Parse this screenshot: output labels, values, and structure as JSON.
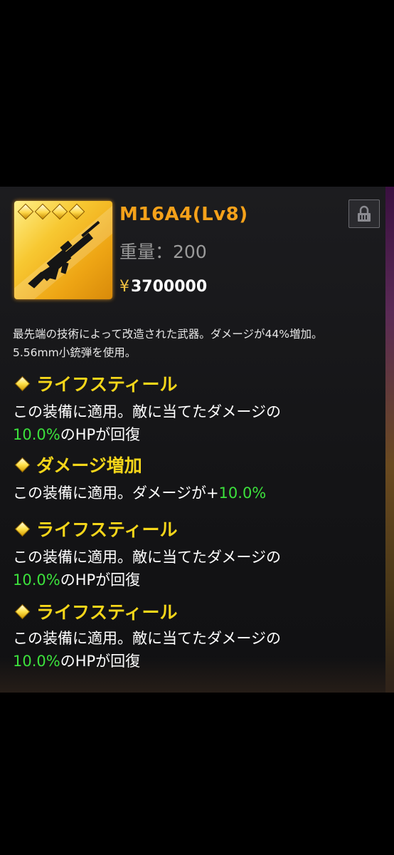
{
  "item": {
    "name": "M16A4(Lv8)",
    "weight_label": "重量：",
    "weight_value": "200",
    "price_symbol": "¥",
    "price_value": "3700000",
    "rarity_stars": 4,
    "icon": "assault-rifle-icon",
    "frame_color": "#f7c832",
    "description": "最先端の技術によって改造された武器。ダメージが44%増加。5.56mm小銃弾を使用。"
  },
  "lock_icon": "lock-icon",
  "skills": [
    {
      "title": "ライフスティール",
      "desc_prefix": "この装備に適用。敵に当てたダメージの",
      "value": "10.0%",
      "desc_suffix": "のHPが回復"
    },
    {
      "title": "ダメージ増加",
      "desc_prefix": "この装備に適用。ダメージが+",
      "value": "10.0%",
      "desc_suffix": ""
    },
    {
      "title": "ライフスティール",
      "desc_prefix": "この装備に適用。敵に当てたダメージの",
      "value": "10.0%",
      "desc_suffix": "のHPが回復"
    },
    {
      "title": "ライフスティール",
      "desc_prefix": "この装備に適用。敵に当てたダメージの",
      "value": "10.0%",
      "desc_suffix": "のHPが回復"
    }
  ],
  "colors": {
    "name": "#f5a11a",
    "skill_title": "#f5d61a",
    "value_green": "#3ce13c"
  }
}
